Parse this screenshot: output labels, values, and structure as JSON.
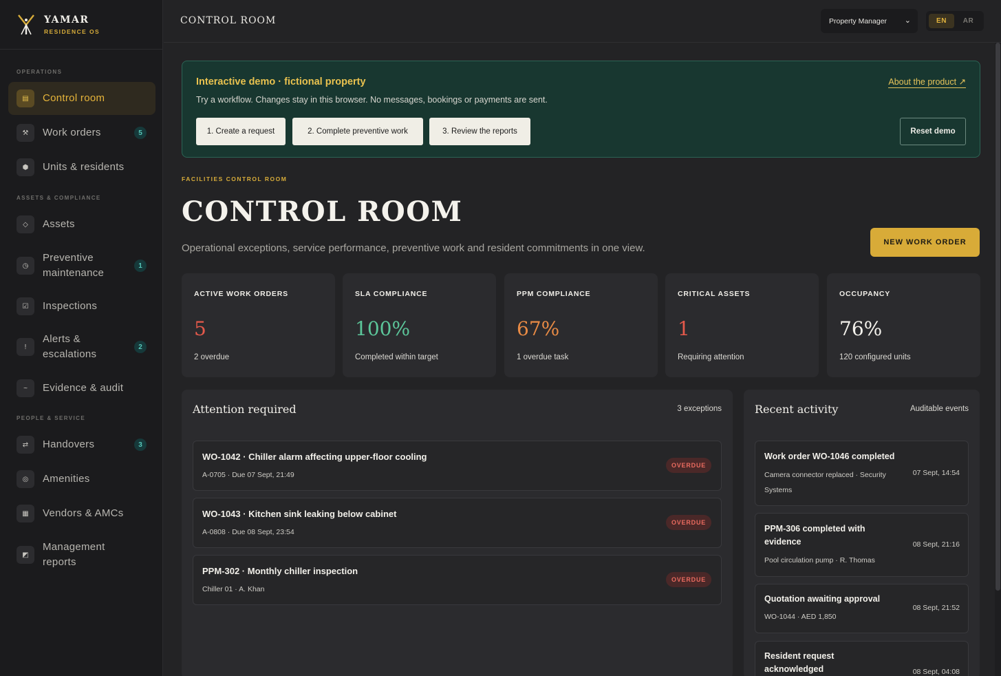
{
  "brand": {
    "name": "YAMAR",
    "sub": "RESIDENCE OS"
  },
  "topbar": {
    "title": "CONTROL ROOM",
    "role": "Property Manager",
    "lang_en": "EN",
    "lang_ar": "AR"
  },
  "sidebar": {
    "sections": [
      "OPERATIONS",
      "ASSETS & COMPLIANCE",
      "PEOPLE & SERVICE"
    ],
    "items": [
      {
        "label": "Control room",
        "icon": "dashboard-icon",
        "badge": ""
      },
      {
        "label": "Work orders",
        "icon": "tools-icon",
        "badge": "5"
      },
      {
        "label": "Units & residents",
        "icon": "building-icon",
        "badge": ""
      },
      {
        "label": "Assets",
        "icon": "diamond-icon",
        "badge": ""
      },
      {
        "label": "Preventive maintenance",
        "icon": "clock-icon",
        "badge": "1"
      },
      {
        "label": "Inspections",
        "icon": "checkbox-icon",
        "badge": ""
      },
      {
        "label": "Alerts & escalations",
        "icon": "alert-icon",
        "badge": "2"
      },
      {
        "label": "Evidence & audit",
        "icon": "wave-icon",
        "badge": ""
      },
      {
        "label": "Handovers",
        "icon": "swap-icon",
        "badge": "3"
      },
      {
        "label": "Amenities",
        "icon": "target-icon",
        "badge": ""
      },
      {
        "label": "Vendors & AMCs",
        "icon": "grid-icon",
        "badge": ""
      },
      {
        "label": "Management reports",
        "icon": "chart-icon",
        "badge": ""
      }
    ]
  },
  "banner": {
    "title": "Interactive demo · fictional property",
    "text": "Try a workflow. Changes stay in this browser. No messages, bookings or payments are sent.",
    "link": "About the product ↗",
    "steps": [
      "1. Create a request",
      "2. Complete preventive work",
      "3. Review the reports"
    ],
    "reset": "Reset demo"
  },
  "header": {
    "eyebrow": "FACILITIES CONTROL ROOM",
    "title": "CONTROL ROOM",
    "subtitle": "Operational exceptions, service performance, preventive work and resident commitments in one view.",
    "new_button": "NEW WORK ORDER"
  },
  "kpis": [
    {
      "label": "ACTIVE WORK ORDERS",
      "value": "5",
      "note": "2 overdue",
      "color": "#e5594b"
    },
    {
      "label": "SLA COMPLIANCE",
      "value": "100%",
      "note": "Completed within target",
      "color": "#5cc69a"
    },
    {
      "label": "PPM COMPLIANCE",
      "value": "67%",
      "note": "1 overdue task",
      "color": "#e98b45"
    },
    {
      "label": "CRITICAL ASSETS",
      "value": "1",
      "note": "Requiring attention",
      "color": "#e5594b"
    },
    {
      "label": "OCCUPANCY",
      "value": "76%",
      "note": "120 configured units",
      "color": "#f4f2ec"
    }
  ],
  "attention": {
    "title": "Attention required",
    "meta": "3 exceptions",
    "rows": [
      {
        "title": "WO-1042 · Chiller alarm affecting upper-floor cooling",
        "sub": "A-0705 · Due 07 Sept, 21:49",
        "badge": "OVERDUE"
      },
      {
        "title": "WO-1043 · Kitchen sink leaking below cabinet",
        "sub": "A-0808 · Due 08 Sept, 23:54",
        "badge": "OVERDUE"
      },
      {
        "title": "PPM-302 · Monthly chiller inspection",
        "sub": "Chiller 01 · A. Khan",
        "badge": "OVERDUE"
      }
    ]
  },
  "activity": {
    "title": "Recent activity",
    "meta": "Auditable events",
    "rows": [
      {
        "title": "Work order WO-1046 completed",
        "sub": "Camera connector replaced · Security Systems",
        "time": "07 Sept, 14:54"
      },
      {
        "title": "PPM-306 completed with evidence",
        "sub": "Pool circulation pump · R. Thomas",
        "time": "08 Sept, 21:16"
      },
      {
        "title": "Quotation awaiting approval",
        "sub": "WO-1044 · AED 1,850",
        "time": "08 Sept, 21:52"
      },
      {
        "title": "Resident request acknowledged",
        "sub": "",
        "time": "08 Sept, 04:08"
      }
    ]
  }
}
